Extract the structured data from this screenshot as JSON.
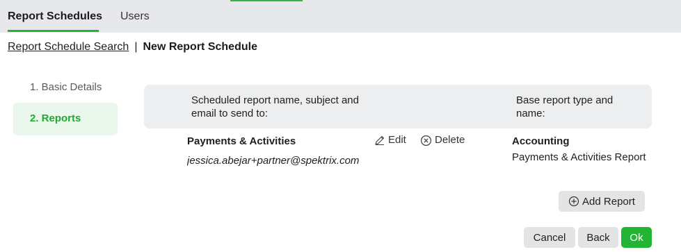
{
  "tabs": {
    "schedules": "Report Schedules",
    "users": "Users"
  },
  "breadcrumb": {
    "link": "Report Schedule Search",
    "separator": "|",
    "current": "New Report Schedule"
  },
  "steps": {
    "step1": "1. Basic Details",
    "step2": "2. Reports"
  },
  "table": {
    "header_name": "Scheduled report name, subject and email to send to:",
    "header_base": "Base report type and name:",
    "rows": [
      {
        "title": "Payments & Activities",
        "email": "jessica.abejar+partner@spektrix.com",
        "edit_label": "Edit",
        "delete_label": "Delete",
        "base_type": "Accounting",
        "base_name": "Payments & Activities Report"
      }
    ]
  },
  "buttons": {
    "add_report": "Add Report",
    "cancel": "Cancel",
    "back": "Back",
    "ok": "Ok"
  },
  "colors": {
    "accent": "#22b433",
    "header_bg": "#e6e8eb",
    "active_step_bg": "#eaf7ec"
  }
}
